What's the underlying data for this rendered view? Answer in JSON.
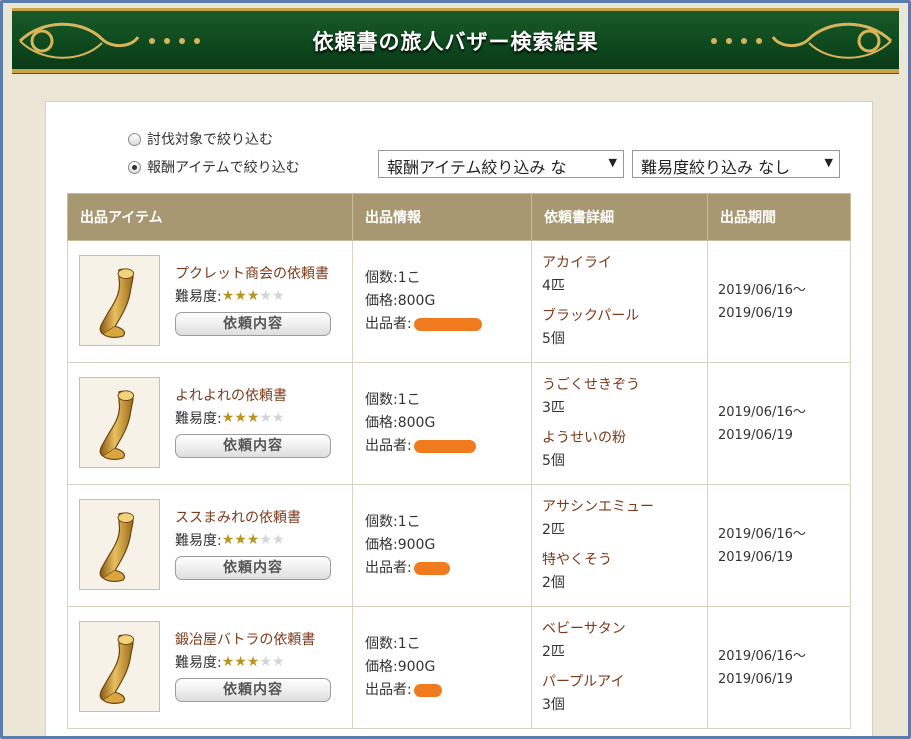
{
  "header": {
    "title": "依頼書の旅人バザー検索結果",
    "colors": {
      "banner": "#0e4a1e",
      "gold": "#c8a248"
    }
  },
  "filters": {
    "radio_monster_label": "討伐対象で絞り込む",
    "radio_reward_label": "報酬アイテムで絞り込む",
    "selected": "reward",
    "reward_select_value": "報酬アイテム絞り込み な",
    "difficulty_select_value": "難易度絞り込み なし"
  },
  "table": {
    "headers": [
      "出品アイテム",
      "出品情報",
      "依頼書詳細",
      "出品期間"
    ],
    "difficulty_label": "難易度:",
    "detail_button_label": "依頼内容",
    "qty_prefix": "個数:",
    "price_prefix": "価格:",
    "seller_prefix": "出品者:",
    "rows": [
      {
        "name": "プクレット商会の依頼書",
        "stars": 3,
        "quantity": "1こ",
        "price": "800G",
        "req1_name": "アカイライ",
        "req1_count": "4匹",
        "req2_name": "ブラックパール",
        "req2_count": "5個",
        "period_start": "2019/06/16～",
        "period_end": "2019/06/19"
      },
      {
        "name": "よれよれの依頼書",
        "stars": 3,
        "quantity": "1こ",
        "price": "800G",
        "req1_name": "うごくせきぞう",
        "req1_count": "3匹",
        "req2_name": "ようせいの粉",
        "req2_count": "5個",
        "period_start": "2019/06/16～",
        "period_end": "2019/06/19"
      },
      {
        "name": "ススまみれの依頼書",
        "stars": 3,
        "quantity": "1こ",
        "price": "900G",
        "req1_name": "アサシンエミュー",
        "req1_count": "2匹",
        "req2_name": "特やくそう",
        "req2_count": "2個",
        "period_start": "2019/06/16～",
        "period_end": "2019/06/19"
      },
      {
        "name": "鍛冶屋バトラの依頼書",
        "stars": 3,
        "quantity": "1こ",
        "price": "900G",
        "req1_name": "ベビーサタン",
        "req1_count": "2匹",
        "req2_name": "パープルアイ",
        "req2_count": "3個",
        "period_start": "2019/06/16～",
        "period_end": "2019/06/19"
      }
    ]
  }
}
